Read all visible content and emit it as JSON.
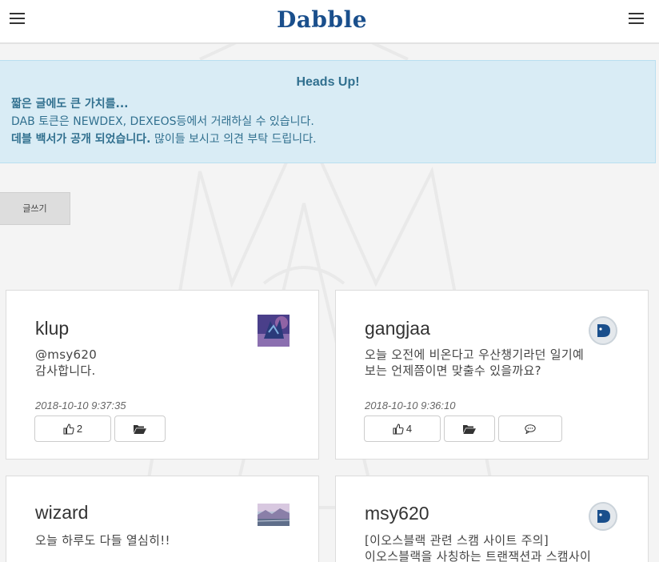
{
  "header": {
    "logo_text": "Dabble",
    "left_menu_icon": "hamburger-menu-icon",
    "right_menu_icon": "hamburger-menu-icon",
    "brand_color": "#1a4f8c"
  },
  "alert": {
    "title": "Heads Up!",
    "line1": "짧은 글에도 큰 가치를...",
    "line2": "DAB 토큰은 NEWDEX, DEXEOS등에서 거래하실 수 있습니다.",
    "line3_bold": "데블 백서가 공개 되었습니다.",
    "line3_rest": " 많이들 보시고 의견 부탁 드립니다.",
    "bg_color": "#d9ecf5",
    "text_color": "#31708f"
  },
  "write_button": {
    "label": "글쓰기"
  },
  "posts": [
    {
      "author": "klup",
      "body": "@msy620\n감사합니다.",
      "time": "2018-10-10 9:37:35",
      "likes": "2",
      "avatar": "robot-image"
    },
    {
      "author": "gangjaa",
      "body": "오늘 오전에 비온다고 우산챙기라던 일기예\n보는 언제쯤이면 맞출수 있을까요?",
      "time": "2018-10-10 9:36:10",
      "likes": "4",
      "avatar": "dabble-logo"
    },
    {
      "author": "wizard",
      "body": "오늘 하루도 다들 열심히!!",
      "avatar": "landscape-image"
    },
    {
      "author": "msy620",
      "body": "[이오스블랙 관련 스캠 사이트 주의]\n이오스블랙을 사칭하는 트랜잭션과 스캠사이",
      "avatar": "dabble-logo"
    }
  ]
}
